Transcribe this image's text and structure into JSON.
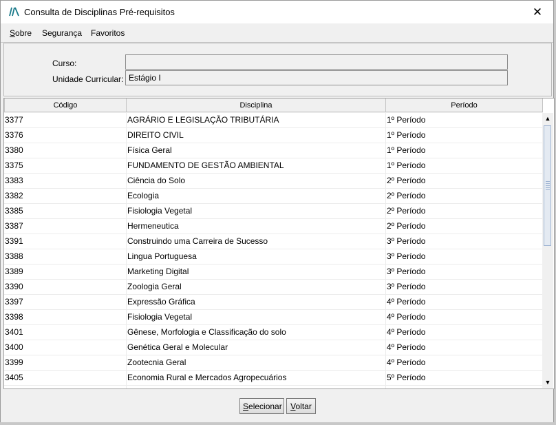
{
  "window": {
    "title": "Consulta de Disciplinas Pré-requisitos",
    "close_glyph": "✕",
    "icon": "app-logo-icon"
  },
  "menu": {
    "items": [
      {
        "first": "S",
        "rest": "obre"
      },
      {
        "first": "",
        "rest": "Segurança"
      },
      {
        "first": "",
        "rest": "Favoritos"
      }
    ]
  },
  "form": {
    "curso_label": "Curso:",
    "curso_value": "",
    "unidade_label": "Unidade Curricular:",
    "unidade_value": "Estágio I"
  },
  "table": {
    "headers": [
      "Código",
      "Disciplina",
      "Período"
    ],
    "rows": [
      [
        "3377",
        "AGRÁRIO E LEGISLAÇÃO TRIBUTÁRIA",
        "1º Período"
      ],
      [
        "3376",
        "DIREITO CIVIL",
        "1º Período"
      ],
      [
        "3380",
        "Física Geral",
        "1º Período"
      ],
      [
        "3375",
        "FUNDAMENTO DE GESTÃO AMBIENTAL",
        "1º Período"
      ],
      [
        "3383",
        "Ciência do Solo",
        "2º Período"
      ],
      [
        "3382",
        "Ecologia",
        "2º Período"
      ],
      [
        "3385",
        "Fisiologia Vegetal",
        "2º Período"
      ],
      [
        "3387",
        "Hermeneutica",
        "2º Período"
      ],
      [
        "3391",
        "Construindo uma Carreira de Sucesso",
        "3º Período"
      ],
      [
        "3388",
        "Lingua Portuguesa",
        "3º Período"
      ],
      [
        "3389",
        "Marketing Digital",
        "3º Período"
      ],
      [
        "3390",
        "Zoologia Geral",
        "3º Período"
      ],
      [
        "3397",
        "Expressão Gráfica",
        "4º Período"
      ],
      [
        "3398",
        "Fisiologia Vegetal",
        "4º Período"
      ],
      [
        "3401",
        "Gênese, Morfologia e Classificação do solo",
        "4º Período"
      ],
      [
        "3400",
        "Genética Geral e Molecular",
        "4º Período"
      ],
      [
        "3399",
        "Zootecnia Geral",
        "4º Período"
      ],
      [
        "3405",
        "Economia Rural e Mercados Agropecuários",
        "5º Período"
      ]
    ]
  },
  "buttons": {
    "select": {
      "first": "S",
      "rest": "elecionar"
    },
    "back": {
      "first": "V",
      "rest": "oltar"
    }
  }
}
